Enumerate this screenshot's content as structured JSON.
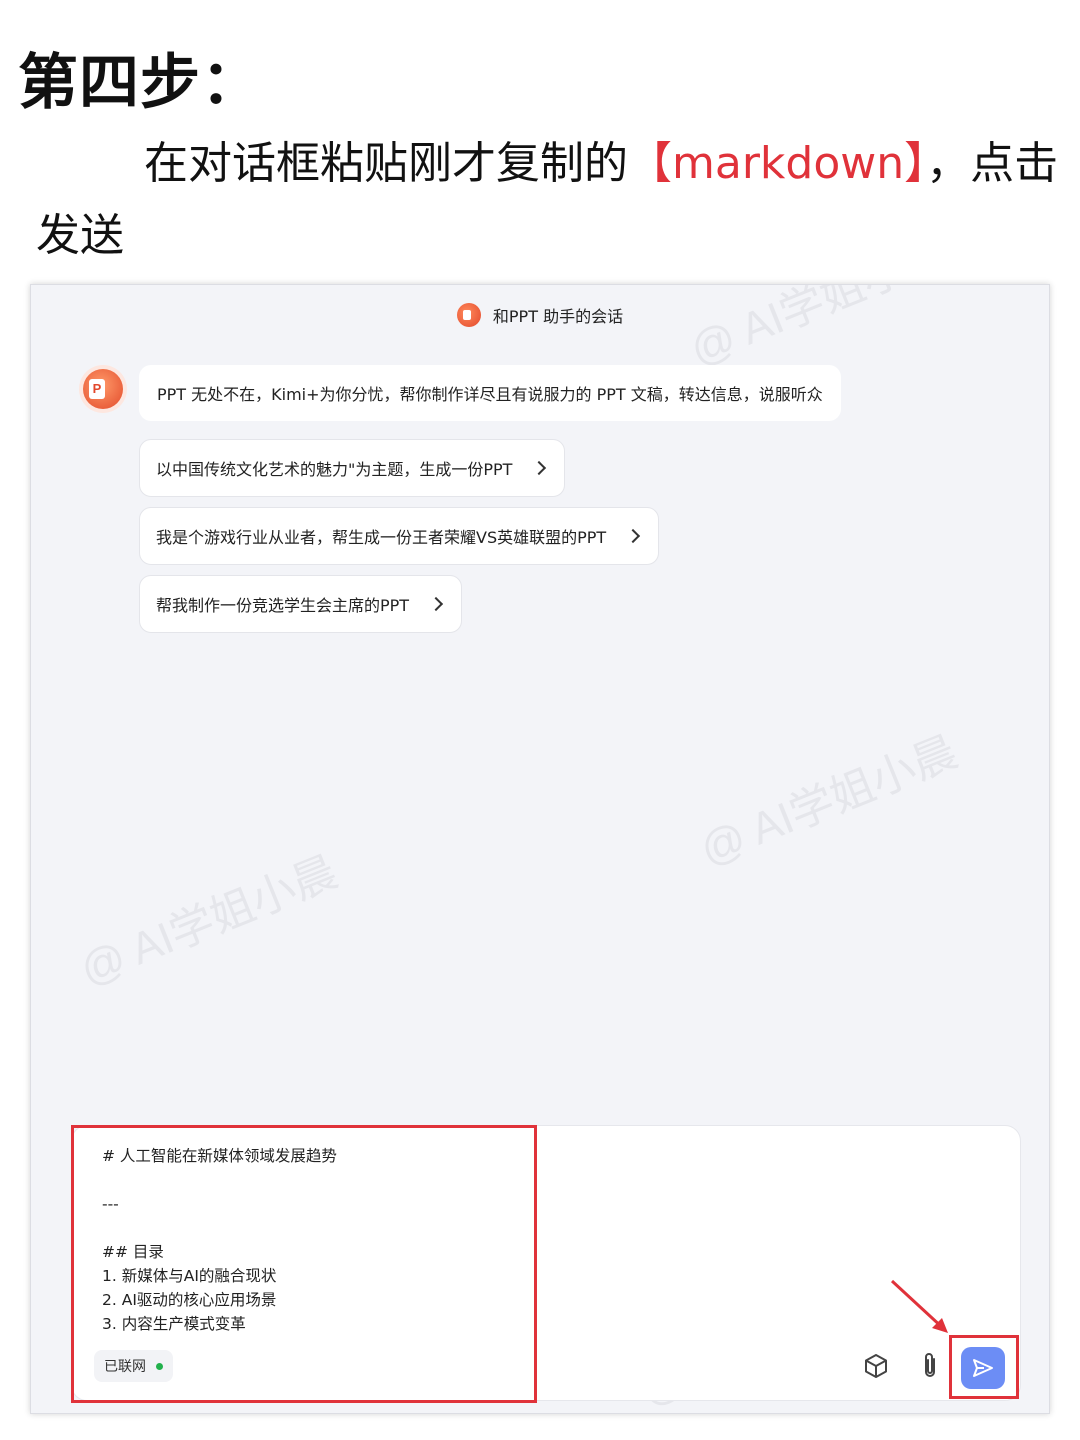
{
  "heading": {
    "step_title": "第四步：",
    "instruction_prefix": "在对话框粘贴刚才复制的",
    "instruction_highlight": "【markdown】",
    "instruction_suffix": "，点击发送"
  },
  "chat": {
    "title": "和PPT 助手的会话",
    "welcome_message": "PPT 无处不在，Kimi+为你分忧，帮你制作详尽且有说服力的 PPT 文稿，转达信息，说服听众",
    "suggestions": [
      "以中国传统文化艺术的魅力\"为主题，生成一份PPT",
      "我是个游戏行业从业者，帮生成一份王者荣耀VS英雄联盟的PPT",
      "帮我制作一份竞选学生会主席的PPT"
    ]
  },
  "composer": {
    "text": "# 人工智能在新媒体领域发展趋势\n\n---\n\n## 目录\n1. 新媒体与AI的融合现状\n2. AI驱动的核心应用场景\n3. 内容生产模式变革",
    "network_label": "已联网"
  },
  "icons": {
    "cube": "cube-icon",
    "attach": "paperclip-icon",
    "send": "send-icon"
  },
  "watermark": "@ AI学姐小晨",
  "colors": {
    "highlight": "#e0323a",
    "send_button": "#6c8df5",
    "online_dot": "#22b14c"
  }
}
